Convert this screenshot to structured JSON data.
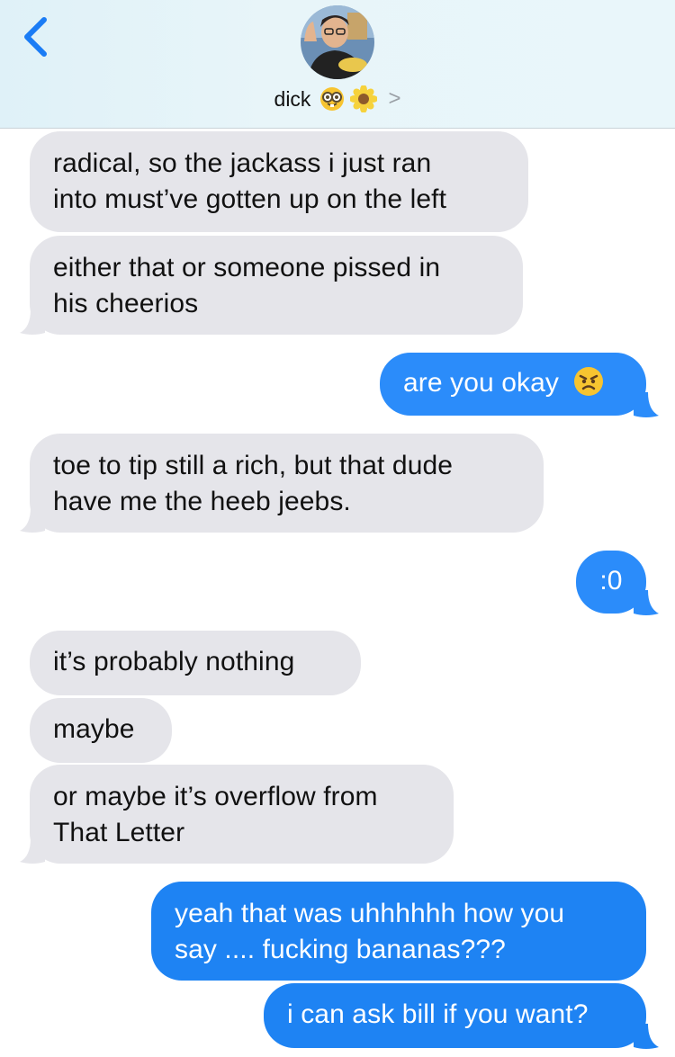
{
  "header": {
    "back_icon": "chevron-left-icon",
    "contact_name": "dick",
    "contact_emojis": [
      "nerd-face-icon",
      "sunflower-icon"
    ],
    "disclosure": ">"
  },
  "messages": [
    {
      "dir": "in",
      "lines": [
        "radical, so the jackass i just ran",
        "into must’ve gotten up on the left"
      ]
    },
    {
      "dir": "in",
      "lines": [
        "either that or someone pissed in",
        "his cheerios"
      ]
    },
    {
      "dir": "out",
      "lines": [
        "are you okay"
      ],
      "emoji": "angry-face-icon"
    },
    {
      "dir": "in",
      "lines": [
        "toe to tip still a rich, but that dude",
        "have me the heeb jeebs."
      ]
    },
    {
      "dir": "out",
      "lines": [
        ":0"
      ]
    },
    {
      "dir": "in",
      "lines": [
        "it’s probably nothing"
      ]
    },
    {
      "dir": "in",
      "lines": [
        "maybe"
      ]
    },
    {
      "dir": "in",
      "lines": [
        "or maybe it’s overflow from",
        "That Letter"
      ]
    },
    {
      "dir": "out",
      "lines": [
        "yeah that was uhhhhhh how you",
        "say .... fucking bananas???"
      ]
    },
    {
      "dir": "out",
      "lines": [
        "i can ask bill if you want?"
      ]
    }
  ],
  "colors": {
    "incoming": "#e5e5ea",
    "outgoing": "#2b8cfa",
    "accent": "#1a7cf5"
  }
}
